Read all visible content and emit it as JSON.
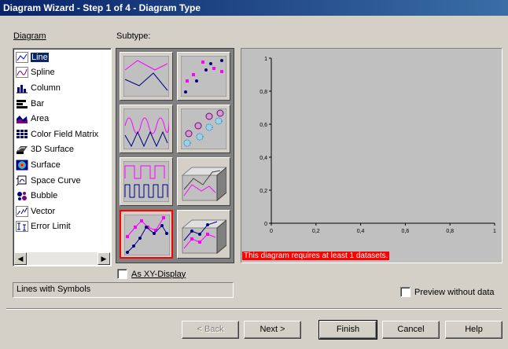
{
  "window": {
    "title": "Diagram Wizard - Step 1 of 4 - Diagram Type"
  },
  "labels": {
    "diagram": "Diagram",
    "subtype": "Subtype:"
  },
  "diagram_types": [
    {
      "label": "Line",
      "icon": "line-chart-icon",
      "selected": true
    },
    {
      "label": "Spline",
      "icon": "spline-chart-icon",
      "selected": false
    },
    {
      "label": "Column",
      "icon": "column-chart-icon",
      "selected": false
    },
    {
      "label": "Bar",
      "icon": "bar-chart-icon",
      "selected": false
    },
    {
      "label": "Area",
      "icon": "area-chart-icon",
      "selected": false
    },
    {
      "label": "Color Field Matrix",
      "icon": "color-field-matrix-icon",
      "selected": false
    },
    {
      "label": "3D Surface",
      "icon": "3d-surface-icon",
      "selected": false
    },
    {
      "label": "Surface",
      "icon": "surface-icon",
      "selected": false
    },
    {
      "label": "Space Curve",
      "icon": "space-curve-icon",
      "selected": false
    },
    {
      "label": "Bubble",
      "icon": "bubble-chart-icon",
      "selected": false
    },
    {
      "label": "Vector",
      "icon": "vector-chart-icon",
      "selected": false
    },
    {
      "label": "Error Limit",
      "icon": "error-limit-icon",
      "selected": false
    }
  ],
  "subtypes": [
    {
      "name": "line-plain",
      "selected": false
    },
    {
      "name": "line-symbols-only",
      "selected": false
    },
    {
      "name": "line-sine",
      "selected": false
    },
    {
      "name": "line-bubbles",
      "selected": false
    },
    {
      "name": "line-step",
      "selected": false
    },
    {
      "name": "line-3d-plain",
      "selected": false
    },
    {
      "name": "line-with-symbols",
      "selected": true
    },
    {
      "name": "line-3d-symbols",
      "selected": false
    }
  ],
  "preview": {
    "x_ticks": [
      "0",
      "0,2",
      "0,4",
      "0,6",
      "0,8",
      "1"
    ],
    "y_ticks": [
      "0",
      "0,2",
      "0,4",
      "0,6",
      "0,8",
      "1"
    ],
    "message": "This diagram requires at least 1 datasets."
  },
  "as_xy_display": {
    "label": "As XY-Display",
    "checked": false
  },
  "description": "Lines with Symbols",
  "preview_without_data": {
    "label": "Preview without data",
    "checked": false
  },
  "buttons": {
    "back": "< Back",
    "next": "Next >",
    "finish": "Finish",
    "cancel": "Cancel",
    "help": "Help"
  },
  "colors": {
    "title_bar": "#0a246a",
    "selection": "#0a246a",
    "error": "#ff0000",
    "series_magenta": "#ff00ff",
    "series_navy": "#000080"
  }
}
